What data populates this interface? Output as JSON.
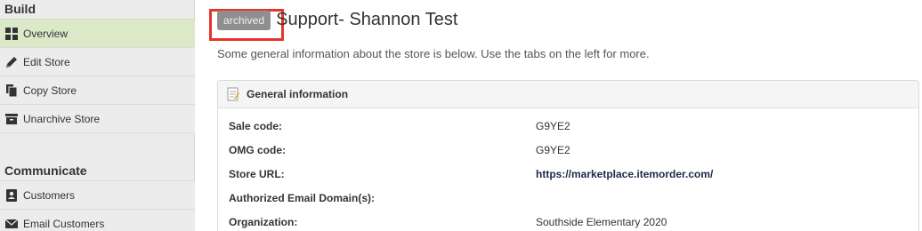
{
  "sidebar": {
    "build_heading": "Build",
    "build_items": [
      {
        "label": "Overview",
        "icon": "grid-icon"
      },
      {
        "label": "Edit Store",
        "icon": "pencil-icon"
      },
      {
        "label": "Copy Store",
        "icon": "copy-icon"
      },
      {
        "label": "Unarchive Store",
        "icon": "archive-icon"
      }
    ],
    "communicate_heading": "Communicate",
    "communicate_items": [
      {
        "label": "Customers",
        "icon": "contact-card-icon"
      },
      {
        "label": "Email Customers",
        "icon": "envelope-icon"
      }
    ]
  },
  "main": {
    "badge": "archived",
    "title": "Support- Shannon Test",
    "subtitle": "Some general information about the store is below. Use the tabs on the left for more.",
    "panel": {
      "header": "General information",
      "rows": [
        {
          "label": "Sale code:",
          "value": "G9YE2"
        },
        {
          "label": "OMG code:",
          "value": "G9YE2"
        },
        {
          "label": "Store URL:",
          "value": "https://marketplace.itemorder.com/"
        },
        {
          "label": "Authorized Email Domain(s):",
          "value": ""
        },
        {
          "label": "Organization:",
          "value": "Southside Elementary 2020"
        }
      ]
    }
  },
  "colors": {
    "active_nav": "#dbe9c9",
    "highlight_box": "#e8342a",
    "badge_bg": "#8f8f8f",
    "link_text": "#1c2b48"
  }
}
